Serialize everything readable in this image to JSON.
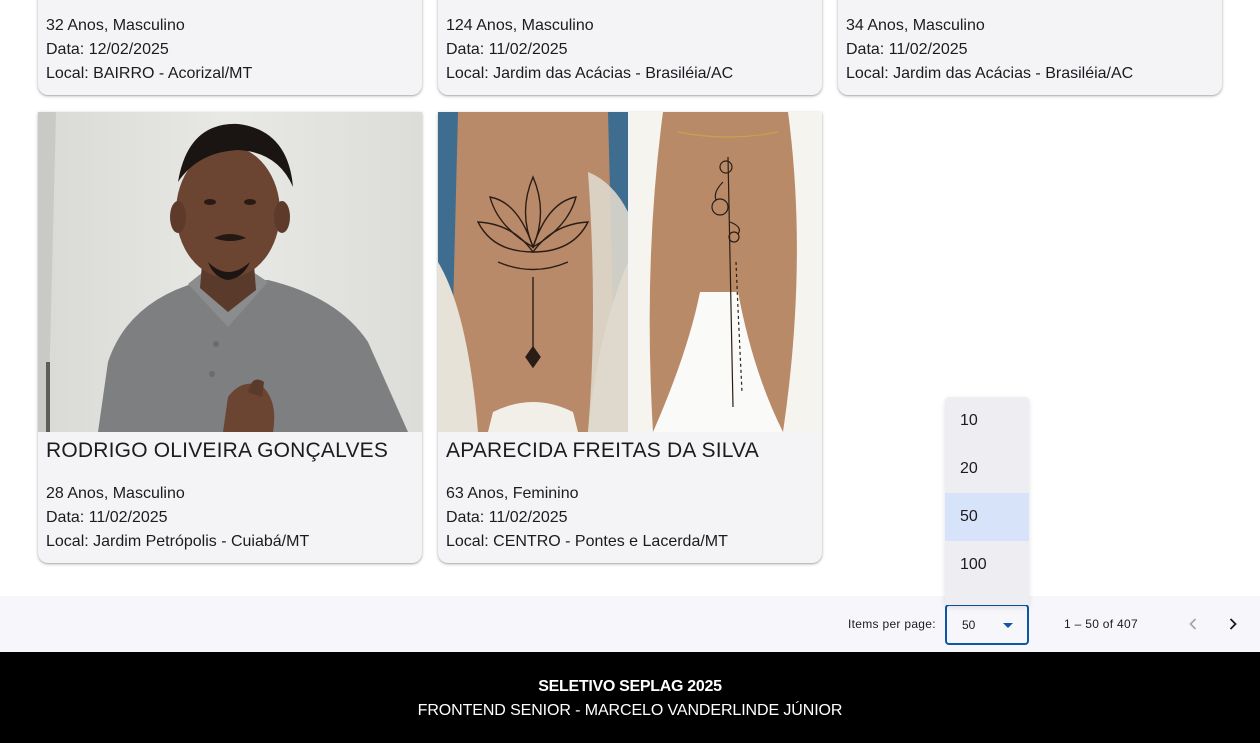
{
  "top_cards": [
    {
      "age_gender": "32 Anos, Masculino",
      "date": "Data: 12/02/2025",
      "location": "Local: BAIRRO - Acorizal/MT"
    },
    {
      "age_gender": "124 Anos, Masculino",
      "date": "Data: 11/02/2025",
      "location": "Local: Jardim das Acácias - Brasiléia/AC"
    },
    {
      "age_gender": "34 Anos, Masculino",
      "date": "Data: 11/02/2025",
      "location": "Local: Jardim das Acácias - Brasiléia/AC"
    }
  ],
  "cards": [
    {
      "name": "RODRIGO OLIVEIRA GONÇALVES",
      "age_gender": "28 Anos, Masculino",
      "date": "Data: 11/02/2025",
      "location": "Local: Jardim Petrópolis - Cuiabá/MT"
    },
    {
      "name": "APARECIDA FREITAS DA SILVA",
      "age_gender": "63 Anos, Feminino",
      "date": "Data: 11/02/2025",
      "location": "Local: CENTRO - Pontes e Lacerda/MT"
    }
  ],
  "paginator": {
    "items_per_page_label": "Items per page:",
    "selected_page_size": "50",
    "range_label": "1 – 50 of 407",
    "options": [
      "10",
      "20",
      "50",
      "100"
    ],
    "prev_icon": "chevron-left-icon",
    "next_icon": "chevron-right-icon"
  },
  "footer": {
    "title": "SELETIVO SEPLAG 2025",
    "subtitle": "FRONTEND SENIOR - MARCELO VANDERLINDE JÚNIOR"
  },
  "colors": {
    "card_bg": "#f4f3f6",
    "accent": "#0b57a8",
    "selected_option_bg": "#d7e3f8",
    "footer_bg": "#000000"
  }
}
